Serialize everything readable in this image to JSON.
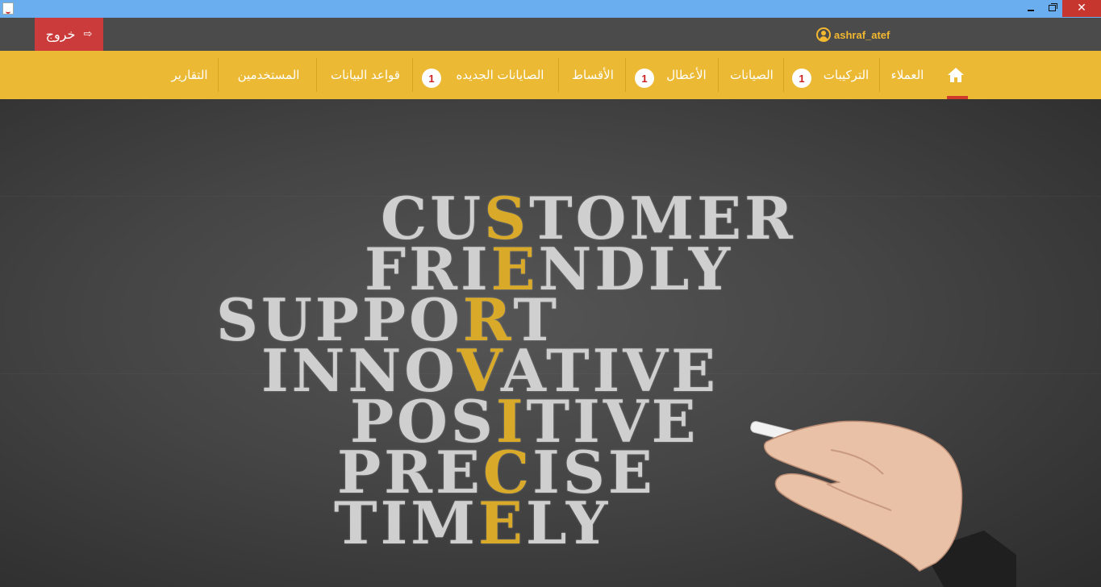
{
  "window": {
    "controls": [
      "minimize-icon",
      "restore-icon",
      "close-icon"
    ],
    "close_glyph": "✕"
  },
  "userbar": {
    "logout_label": "خروج",
    "logout_glyph": "⇨",
    "username": "ashraf_atef"
  },
  "nav": {
    "items": [
      {
        "label": "العملاء"
      },
      {
        "label": "التركيبات",
        "badge": "1"
      },
      {
        "label": "الصيانات"
      },
      {
        "label": "الأعطال",
        "badge": "1"
      },
      {
        "label": "الأقساط"
      },
      {
        "label": "الصايانات الجديده",
        "badge": "1"
      },
      {
        "label": "قواعد البيانات"
      },
      {
        "label": "المستخدمين"
      },
      {
        "label": "التقارير"
      }
    ]
  },
  "banner": {
    "words": [
      {
        "pre": "CU",
        "hl": "S",
        "post": "TOMER"
      },
      {
        "pre": "FRI",
        "hl": "E",
        "post": "NDLY"
      },
      {
        "pre": "SUPPO",
        "hl": "R",
        "post": "T"
      },
      {
        "pre": "INNO",
        "hl": "V",
        "post": "ATIVE"
      },
      {
        "pre": "POS",
        "hl": "I",
        "post": "TIVE"
      },
      {
        "pre": "PRE",
        "hl": "C",
        "post": "ISE"
      },
      {
        "pre": "TIM",
        "hl": "E",
        "post": "LY"
      }
    ]
  },
  "colors": {
    "titlebar": "#6aaef0",
    "userbar": "#4b4b4b",
    "logout": "#cc3b3b",
    "nav": "#ecb934",
    "accent": "#d9aa2a",
    "badge_text": "#cc1f1f"
  }
}
